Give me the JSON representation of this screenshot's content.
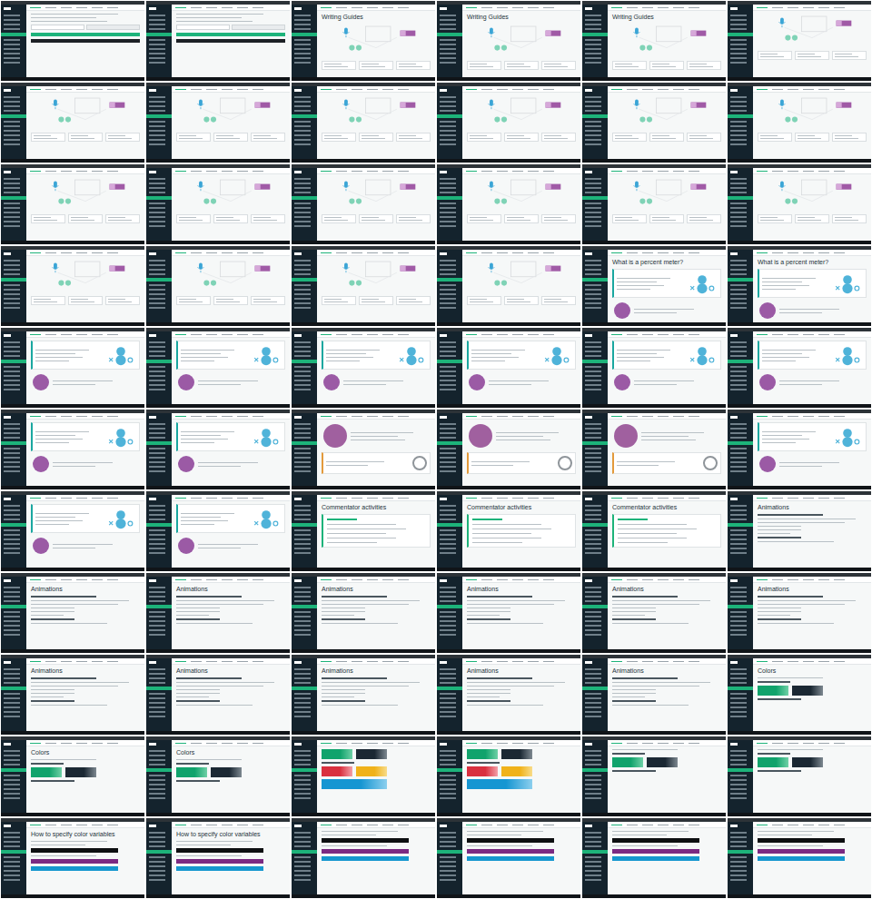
{
  "sheet": {
    "columns": 6,
    "rows": 11
  },
  "frames": [
    {
      "kind": "form"
    },
    {
      "kind": "form"
    },
    {
      "kind": "diagram",
      "title": "Writing Guides"
    },
    {
      "kind": "diagram",
      "title": "Writing Guides"
    },
    {
      "kind": "diagram",
      "title": "Writing Guides"
    },
    {
      "kind": "diagram"
    },
    {
      "kind": "diagram"
    },
    {
      "kind": "diagram"
    },
    {
      "kind": "diagram"
    },
    {
      "kind": "diagram"
    },
    {
      "kind": "diagram"
    },
    {
      "kind": "diagram"
    },
    {
      "kind": "diagram"
    },
    {
      "kind": "diagram"
    },
    {
      "kind": "diagram"
    },
    {
      "kind": "diagram"
    },
    {
      "kind": "diagram"
    },
    {
      "kind": "diagram"
    },
    {
      "kind": "diagram"
    },
    {
      "kind": "diagram"
    },
    {
      "kind": "diagram"
    },
    {
      "kind": "diagram"
    },
    {
      "kind": "meter",
      "title": "What is a percent meter?"
    },
    {
      "kind": "meter",
      "title": "What is a percent meter?"
    },
    {
      "kind": "meter"
    },
    {
      "kind": "meter"
    },
    {
      "kind": "meter"
    },
    {
      "kind": "meter"
    },
    {
      "kind": "meter"
    },
    {
      "kind": "meter"
    },
    {
      "kind": "meter"
    },
    {
      "kind": "meter"
    },
    {
      "kind": "handshake"
    },
    {
      "kind": "handshake"
    },
    {
      "kind": "handshake"
    },
    {
      "kind": "meter"
    },
    {
      "kind": "meter"
    },
    {
      "kind": "meter"
    },
    {
      "kind": "list",
      "title": "Commentator activities"
    },
    {
      "kind": "list",
      "title": "Commentator activities"
    },
    {
      "kind": "list",
      "title": "Commentator activities"
    },
    {
      "kind": "text",
      "title": "Animations"
    },
    {
      "kind": "text",
      "title": "Animations"
    },
    {
      "kind": "text",
      "title": "Animations"
    },
    {
      "kind": "text",
      "title": "Animations"
    },
    {
      "kind": "text",
      "title": "Animations"
    },
    {
      "kind": "text",
      "title": "Animations"
    },
    {
      "kind": "text",
      "title": "Animations"
    },
    {
      "kind": "text",
      "title": "Animations"
    },
    {
      "kind": "text",
      "title": "Animations"
    },
    {
      "kind": "text",
      "title": "Animations"
    },
    {
      "kind": "text",
      "title": "Animations"
    },
    {
      "kind": "text",
      "title": "Animations"
    },
    {
      "kind": "colors",
      "title": "Colors"
    },
    {
      "kind": "colors",
      "title": "Colors"
    },
    {
      "kind": "colors",
      "title": "Colors"
    },
    {
      "kind": "palette"
    },
    {
      "kind": "palette"
    },
    {
      "kind": "colors"
    },
    {
      "kind": "colors"
    },
    {
      "kind": "variables",
      "title": "How to specify color variables"
    },
    {
      "kind": "variables",
      "title": "How to specify color variables"
    },
    {
      "kind": "variables"
    },
    {
      "kind": "variables"
    },
    {
      "kind": "variables"
    },
    {
      "kind": "variables"
    }
  ]
}
